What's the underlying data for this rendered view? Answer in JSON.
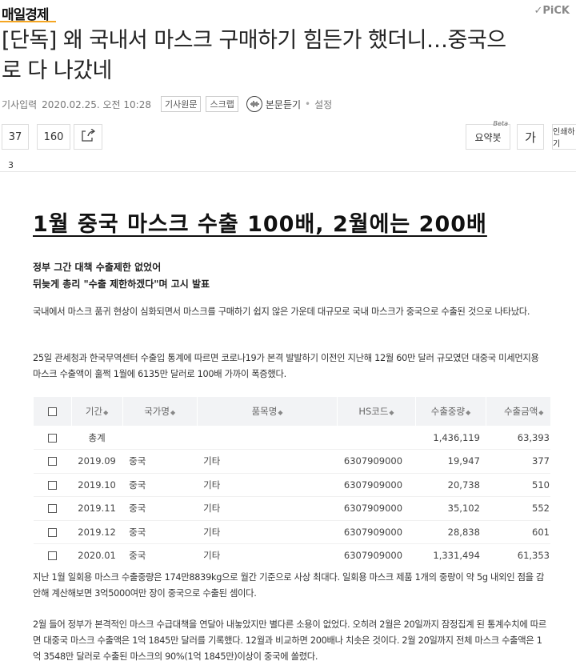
{
  "header": {
    "brand": "매일경제",
    "pick": "✓PiCK"
  },
  "article": {
    "title_line1": "[단독] 왜 국내서 마스크 구매하기 힘든가 했더니…중국으",
    "title_line2": "로 다 나갔네",
    "meta": {
      "label": "기사입력",
      "date": "2020.02.25. 오전 10:28",
      "original_btn": "기사원문",
      "scrap_btn": "스크랩",
      "listen": "본문듣기",
      "dot": "•",
      "settings": "설정"
    },
    "actions": {
      "likes": "37",
      "comments": "160",
      "summary": "요약봇",
      "summary_beta": "Beta",
      "font": "가",
      "print": "인쇄하기"
    },
    "page_num": "3",
    "subheading": "1월 중국 마스크 수출 100배, 2월에는 200배",
    "lead_line1": "정부 그간 대책 수출제한 없었어",
    "lead_line2": "뒤늦게 총리 \"수출 제한하겠다\"며 고시 발표",
    "para1": "국내에서 마스크 품귀 현상이 심화되면서 마스크를 구매하기 쉽지 않은 가운데 대규모로 국내 마스크가 중국으로 수출된 것으로 나타났다.",
    "para2": "25일 관세청과 한국무역센터 수출입 통계에 따르면 코로나19가 본격 발발하기 이전인 지난해 12월 60만 달러 규모였던 대중국 미세먼지용 마스크 수출액이 훌쩍 1월에 6135만 달러로 100배 가까이 폭증했다.",
    "para3": "지난 1월 일회용 마스크 수출중량은 174만8839kg으로 월간 기준으로 사상 최대다. 일회용 마스크 제품 1개의 중량이 약 5g 내외인 점을 감안해 계산해보면 3억5000여만 장이 중국으로 수출된 셈이다.",
    "para4": "2월 들어 정부가 본격적인 마스크 수급대책을 연달아 내놓았지만 별다른 소용이 없었다. 오히려 2월은 20일까지 잠정집계 된 통계수치에 따르면 대중국 마스크 수출액은 1억 1845만 달러를 기록했다. 12월과 비교하면 200배나 치솟은 것이다. 2월 20일까지 전체 마스크 수출액은 1억 3548만 달러로 수출된 마스크의 90%(1억 1845만)이상이 중국에 쏠렸다."
  },
  "table": {
    "headers": [
      "기간",
      "국가명",
      "품목명",
      "HS코드",
      "수출중량",
      "수출금액"
    ],
    "sort_icon": "◆",
    "rows": [
      {
        "period": "총계",
        "country": "",
        "item": "",
        "hs": "",
        "weight": "1,436,119",
        "amount": "63,393"
      },
      {
        "period": "2019.09",
        "country": "중국",
        "item": "기타",
        "hs": "6307909000",
        "weight": "19,947",
        "amount": "377"
      },
      {
        "period": "2019.10",
        "country": "중국",
        "item": "기타",
        "hs": "6307909000",
        "weight": "20,738",
        "amount": "510"
      },
      {
        "period": "2019.11",
        "country": "중국",
        "item": "기타",
        "hs": "6307909000",
        "weight": "35,102",
        "amount": "552"
      },
      {
        "period": "2019.12",
        "country": "중국",
        "item": "기타",
        "hs": "6307909000",
        "weight": "28,838",
        "amount": "601"
      },
      {
        "period": "2020.01",
        "country": "중국",
        "item": "기타",
        "hs": "6307909000",
        "weight": "1,331,494",
        "amount": "61,353"
      }
    ]
  }
}
